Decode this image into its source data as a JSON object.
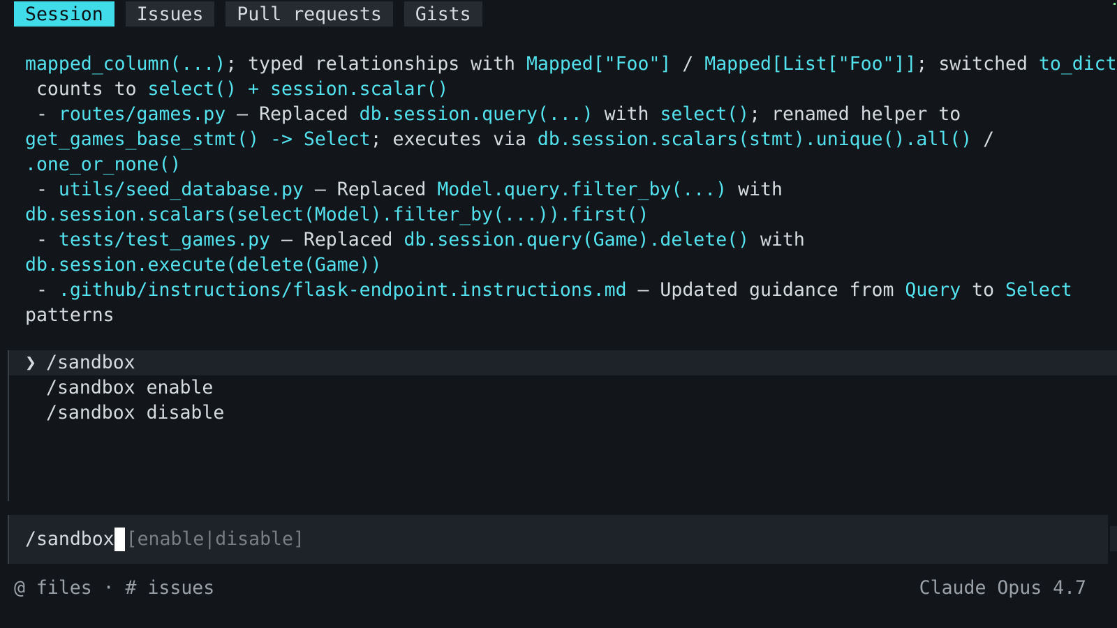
{
  "tabs": [
    {
      "label": "Session",
      "active": true
    },
    {
      "label": "Issues",
      "active": false
    },
    {
      "label": "Pull requests",
      "active": false
    },
    {
      "label": "Gists",
      "active": false
    }
  ],
  "output_lines": [
    [
      {
        "t": "mapped_column(...)",
        "c": "c"
      },
      {
        "t": "; typed relationships with ",
        "c": "w"
      },
      {
        "t": "Mapped[\"Foo\"]",
        "c": "c"
      },
      {
        "t": " / ",
        "c": "w"
      },
      {
        "t": "Mapped[List[\"Foo\"]]",
        "c": "c"
      },
      {
        "t": "; switched ",
        "c": "w"
      },
      {
        "t": "to_dict",
        "c": "c"
      }
    ],
    [
      {
        "t": " counts to ",
        "c": "w"
      },
      {
        "t": "select() + session.scalar()",
        "c": "c"
      }
    ],
    [
      {
        "t": " - ",
        "c": "w"
      },
      {
        "t": "routes/games.py",
        "c": "c"
      },
      {
        "t": " — Replaced ",
        "c": "w"
      },
      {
        "t": "db.session.query(...)",
        "c": "c"
      },
      {
        "t": " with ",
        "c": "w"
      },
      {
        "t": "select()",
        "c": "c"
      },
      {
        "t": "; renamed helper to",
        "c": "w"
      }
    ],
    [
      {
        "t": "get_games_base_stmt() -> Select",
        "c": "c"
      },
      {
        "t": "; executes via ",
        "c": "w"
      },
      {
        "t": "db.session.scalars(stmt).unique().all()",
        "c": "c"
      },
      {
        "t": " /",
        "c": "w"
      }
    ],
    [
      {
        "t": ".one_or_none()",
        "c": "c"
      }
    ],
    [
      {
        "t": " - ",
        "c": "w"
      },
      {
        "t": "utils/seed_database.py",
        "c": "c"
      },
      {
        "t": " — Replaced ",
        "c": "w"
      },
      {
        "t": "Model.query.filter_by(...)",
        "c": "c"
      },
      {
        "t": " with",
        "c": "w"
      }
    ],
    [
      {
        "t": "db.session.scalars(select(Model).filter_by(...)).first()",
        "c": "c"
      }
    ],
    [
      {
        "t": " - ",
        "c": "w"
      },
      {
        "t": "tests/test_games.py",
        "c": "c"
      },
      {
        "t": " — Replaced ",
        "c": "w"
      },
      {
        "t": "db.session.query(Game).delete()",
        "c": "c"
      },
      {
        "t": " with",
        "c": "w"
      }
    ],
    [
      {
        "t": "db.session.execute(delete(Game))",
        "c": "c"
      }
    ],
    [
      {
        "t": " - ",
        "c": "w"
      },
      {
        "t": ".github/instructions/flask-endpoint.instructions.md",
        "c": "c"
      },
      {
        "t": " — Updated guidance from ",
        "c": "w"
      },
      {
        "t": "Query",
        "c": "c"
      },
      {
        "t": " to ",
        "c": "w"
      },
      {
        "t": "Select",
        "c": "c"
      }
    ],
    [
      {
        "t": "patterns",
        "c": "w"
      }
    ]
  ],
  "menu": {
    "selected_marker": "❯",
    "items": [
      "/sandbox",
      "/sandbox enable",
      "/sandbox disable"
    ]
  },
  "input": {
    "value": "/sandbox",
    "hint": "[enable|disable]"
  },
  "footer": {
    "left": "@ files · # issues",
    "right": "Claude Opus 4.7"
  }
}
